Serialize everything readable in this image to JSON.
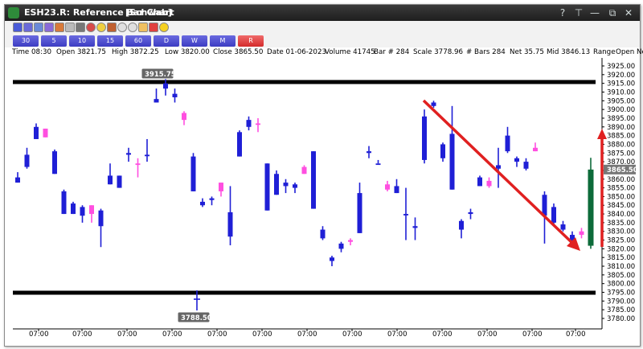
{
  "window": {
    "title": "ESH23.R: Reference Bar Chart",
    "account": "[Schwab]",
    "buttons": [
      "?",
      "⊤",
      "—",
      "⧉",
      "✕"
    ]
  },
  "toolbar": {
    "icons": [
      "bar-chart-icon",
      "candle-icon",
      "line-chart-icon",
      "indicator-icon",
      "grid-icon",
      "crosshair-icon",
      "print-icon",
      "target-icon",
      "sun-icon",
      "lock-icon",
      "zoom-in-icon",
      "zoom-out-icon",
      "save-icon",
      "arrow-icon",
      "star-icon"
    ]
  },
  "periods": [
    {
      "label": "30",
      "color": "#4a4ad6"
    },
    {
      "label": "5",
      "color": "#4a4ad6"
    },
    {
      "label": "10",
      "color": "#4a4ad6"
    },
    {
      "label": "15",
      "color": "#4a4ad6"
    },
    {
      "label": "60",
      "color": "#4a4ad6"
    },
    {
      "label": "D",
      "color": "#4a4ad6"
    },
    {
      "label": "W",
      "color": "#4a4ad6"
    },
    {
      "label": "M",
      "color": "#4a4ad6"
    },
    {
      "label": "R",
      "color": "#e03a3a"
    }
  ],
  "info": {
    "time": "Time 08:30",
    "open": "Open 3821.75",
    "high": "High 3872.25",
    "low": "Low 3820.00",
    "close": "Close 3865.50",
    "date": "Date 01-06-2023",
    "volume": "Volume 41745",
    "bar": "Bar # 284",
    "scale": "Scale 3778.96",
    "bars": "# Bars 284",
    "net": "Net 35.75",
    "mid": "Mid 3846.13",
    "range": "Range",
    "open_range": "Open Ne"
  },
  "chart_data": {
    "type": "candlestick",
    "ylim": [
      3778.96,
      3928
    ],
    "y_ticks": [
      "3925.00",
      "3920.00",
      "3915.00",
      "3910.00",
      "3905.00",
      "3900.00",
      "3895.00",
      "3890.00",
      "3885.00",
      "3880.00",
      "3875.00",
      "3870.00",
      "3865.00",
      "3860.00",
      "3855.00",
      "3850.00",
      "3845.00",
      "3840.00",
      "3835.00",
      "3830.00",
      "3825.00",
      "3820.00",
      "3815.00",
      "3810.00",
      "3805.00",
      "3800.00",
      "3795.00",
      "3790.00",
      "3785.00",
      "3780.00"
    ],
    "x_labels": [
      "07:00",
      "07:00",
      "07:00",
      "07:00",
      "07:00",
      "07:00",
      "07:00",
      "07:00",
      "07:00",
      "07:00",
      "07:00",
      "07:00",
      "07:00"
    ],
    "resistance": 3915.75,
    "support": 3788.5,
    "resistance_label": "3915.75",
    "support_label": "3788.50",
    "last_price_label": "3865.50",
    "colors": {
      "down": "#1f1fd6",
      "up": "#ff4fe0",
      "last": "#0d6b3a",
      "level": "#000000",
      "arrow": "#e02020"
    },
    "bars": [
      [
        3861,
        3864,
        3858,
        3858,
        "down"
      ],
      [
        3874,
        3878,
        3866,
        3867,
        "down"
      ],
      [
        3890,
        3892,
        3883,
        3883,
        "down"
      ],
      [
        3884,
        3889,
        3884,
        3889,
        "up"
      ],
      [
        3876,
        3877,
        3863,
        3863,
        "down"
      ],
      [
        3853,
        3854,
        3840,
        3840,
        "down"
      ],
      [
        3846,
        3847,
        3840,
        3840,
        "down"
      ],
      [
        3844,
        3845,
        3835,
        3839,
        "down"
      ],
      [
        3840,
        3845,
        3835,
        3845,
        "up"
      ],
      [
        3842,
        3843,
        3821,
        3833,
        "down"
      ],
      [
        3862,
        3869,
        3857,
        3857,
        "down"
      ],
      [
        3862,
        3862,
        3855,
        3855,
        "down"
      ],
      [
        3875,
        3878,
        3870,
        3874,
        "down"
      ],
      [
        3869,
        3872,
        3861,
        3869,
        "up"
      ],
      [
        3874,
        3883,
        3870,
        3874,
        "down"
      ],
      [
        3906,
        3912,
        3904,
        3904,
        "down"
      ],
      [
        3912,
        3920,
        3908,
        3915,
        "down"
      ],
      [
        3909,
        3912,
        3904,
        3907,
        "down"
      ],
      [
        3894,
        3899,
        3891,
        3898,
        "up"
      ],
      [
        3873,
        3875,
        3853,
        3853,
        "down"
      ],
      [
        3847,
        3849,
        3844,
        3845,
        "down"
      ],
      [
        3848,
        3850,
        3845,
        3849,
        "down"
      ],
      [
        3853,
        3858,
        3850,
        3858,
        "up"
      ],
      [
        3841,
        3856,
        3822,
        3827,
        "down"
      ],
      [
        3887,
        3888,
        3873,
        3873,
        "down"
      ],
      [
        3894,
        3896,
        3888,
        3890,
        "down"
      ],
      [
        3892,
        3895,
        3887,
        3892,
        "up"
      ],
      [
        3869,
        3869,
        3842,
        3842,
        "down"
      ],
      [
        3863,
        3865,
        3851,
        3851,
        "down"
      ],
      [
        3858,
        3860,
        3852,
        3856,
        "down"
      ],
      [
        3857,
        3858,
        3852,
        3855,
        "down"
      ],
      [
        3867,
        3868,
        3863,
        3863,
        "up"
      ],
      [
        3876,
        3876,
        3843,
        3843,
        "down"
      ],
      [
        3831,
        3833,
        3825,
        3826,
        "down"
      ],
      [
        3815,
        3816,
        3810,
        3813,
        "down"
      ],
      [
        3823,
        3824,
        3818,
        3820,
        "down"
      ],
      [
        3824,
        3826,
        3822,
        3825,
        "up"
      ],
      [
        3852,
        3858,
        3829,
        3829,
        "down"
      ],
      [
        3876,
        3879,
        3872,
        3875,
        "down"
      ],
      [
        3869,
        3871,
        3869,
        3869,
        "down"
      ],
      [
        3857,
        3859,
        3853,
        3854,
        "up"
      ],
      [
        3856,
        3860,
        3852,
        3852,
        "down"
      ],
      [
        3840,
        3855,
        3825,
        3840,
        "down"
      ],
      [
        3833,
        3838,
        3825,
        3832,
        "down"
      ],
      [
        3896,
        3900,
        3869,
        3871,
        "down"
      ],
      [
        3904,
        3905,
        3901,
        3902,
        "down"
      ],
      [
        3880,
        3881,
        3870,
        3872,
        "down"
      ],
      [
        3886,
        3902,
        3854,
        3854,
        "down"
      ],
      [
        3836,
        3837,
        3826,
        3831,
        "down"
      ],
      [
        3841,
        3843,
        3837,
        3840,
        "down"
      ],
      [
        3861,
        3862,
        3856,
        3856,
        "down"
      ],
      [
        3859,
        3861,
        3855,
        3856,
        "up"
      ],
      [
        3866,
        3878,
        3855,
        3868,
        "down"
      ],
      [
        3885,
        3890,
        3875,
        3876,
        "down"
      ],
      [
        3872,
        3873,
        3867,
        3870,
        "down"
      ],
      [
        3870,
        3872,
        3865,
        3866,
        "down"
      ],
      [
        3878,
        3881,
        3876,
        3876,
        "up"
      ],
      [
        3851,
        3853,
        3823,
        3839,
        "down"
      ],
      [
        3844,
        3846,
        3834,
        3835,
        "down"
      ],
      [
        3834,
        3836,
        3830,
        3831,
        "down"
      ],
      [
        3828,
        3830,
        3823,
        3823,
        "down"
      ],
      [
        3830,
        3832,
        3826,
        3828,
        "up"
      ],
      [
        3821.75,
        3872.25,
        3820,
        3865.5,
        "last"
      ]
    ]
  }
}
